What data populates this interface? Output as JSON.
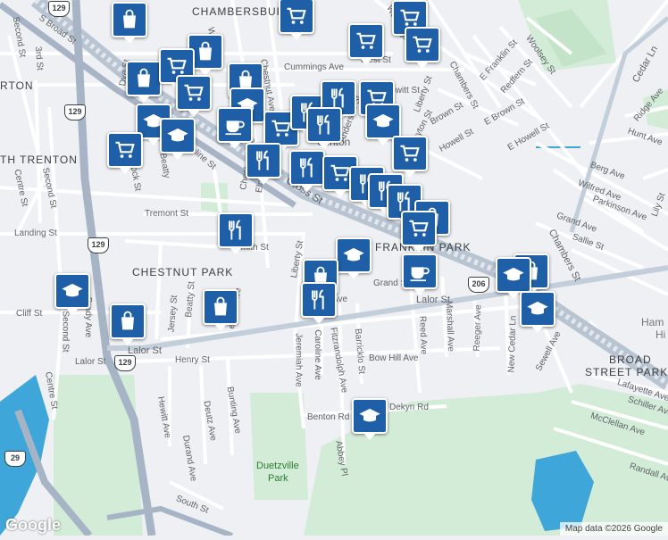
{
  "map": {
    "neighborhoods": {
      "chambersburg": "CHAMBERSBURG",
      "trenton": "RTON",
      "south_trenton": "TH TRENTON",
      "franklin_park": "FRANKLIN PARK",
      "chestnut_park": "CHESTNUT PARK",
      "broad_street_park_1": "BROAD",
      "broad_street_park_2": "STREET PARK",
      "hamilton_1": "Ham",
      "hamilton_2": "Hi"
    },
    "parks": {
      "duetzville_1": "Duetzville",
      "duetzville_2": "Park"
    },
    "route_shields": {
      "r129a": "129",
      "r129b": "129",
      "r129c": "129",
      "r129d": "129",
      "r206": "206",
      "r29": "29"
    },
    "streets": {
      "s_broad": "S Broad St",
      "second_st_tl": "Second St",
      "third_st_tl": "3rd St",
      "dye_st": "Dye St",
      "cummings": "Cummings Ave",
      "west_st": "West St",
      "washington": "Washington St",
      "chambers": "Chambers St",
      "e_franklin": "E Franklin St",
      "redfern": "Redfern St",
      "woolsey": "Woolsey St",
      "e_brown": "E Brown St",
      "brown": "Brown St",
      "dayton": "Dayton St",
      "howell": "Howell St",
      "e_howell": "E Howell St",
      "hewitt": "Hewitt St",
      "anderson": "Anderson St",
      "liberty_n": "Liberty St",
      "clinton": "Clinton",
      "chestnut_n": "Chestnut Ave",
      "whittaker": "Whittaker",
      "adeline": "Adeline St",
      "beatty_n": "Beatty",
      "brock": "Brock St",
      "chestnut_mid": "Chestnut Ave",
      "elm": "Elm St",
      "tremont": "Tremont St",
      "landing": "Landing St",
      "smith": "Smith St",
      "centre": "Centre St",
      "second_st": "Second St",
      "cross": "Cross St",
      "liberty": "Liberty St",
      "grand": "Grand St",
      "lalor_st_e": "Lalor St",
      "lalor_st_w": "Lalor St",
      "lalor_st_far": "Lalor St",
      "ave": "Ave",
      "beatty": "Beatty St",
      "jersey": "Jersey St",
      "cliff": "Cliff St",
      "second_st2": "Second St",
      "brady": "Brady Ave",
      "henry": "Henry St",
      "jeremiah": "Jeremiah Ave",
      "caroline": "Caroline Ave",
      "fitzrandolph": "Fitzrandolph Ave",
      "barricklo": "Barricklo St",
      "bow_hill": "Bow Hill Ave",
      "benton": "Benton Rd",
      "dekyn": "Dekyn Rd",
      "abbey": "Abbey Pl",
      "reed": "Reed Ave",
      "marshall": "Marshall Ave",
      "reeger": "Reeger Ave",
      "new_cedar": "New Cedar Ln",
      "cedar": "Cedar Ln",
      "sewell": "Sewell Ave",
      "hewitt_s": "Hewitt Ave",
      "deutz": "Deutz Ave",
      "bunting": "Bunting Ave",
      "durand": "Durand Ave",
      "south": "South St",
      "centre_s": "Centre St",
      "lafayette": "Lafayette Ave",
      "schiller": "Schiller Ave",
      "mcclellan": "McClellan Ave",
      "randall": "Randall Av",
      "berg": "Berg Ave",
      "wilfred": "Wilfred Ave",
      "parkinson": "Parkinson Ave",
      "grand_ave": "Grand Ave",
      "sallie": "Sallie St",
      "chambers_e": "Chambers St",
      "hunt": "Hunt Ave",
      "ridge": "Ridge Ave",
      "lily": "Lily St",
      "chestnut_s": "estnut Ave"
    },
    "poi_icon_names": [
      "shopping-bag-icon",
      "shopping-cart-icon",
      "restaurant-icon",
      "cafe-icon",
      "school-icon"
    ]
  },
  "logo": "Google",
  "attribution": "Map data ©2026 Google",
  "colors": {
    "marker": "#1e5fa8",
    "road": "#ffffff",
    "highway": "#a6b4c6",
    "water": "#3fa6d9",
    "park": "#d3ecd7"
  }
}
